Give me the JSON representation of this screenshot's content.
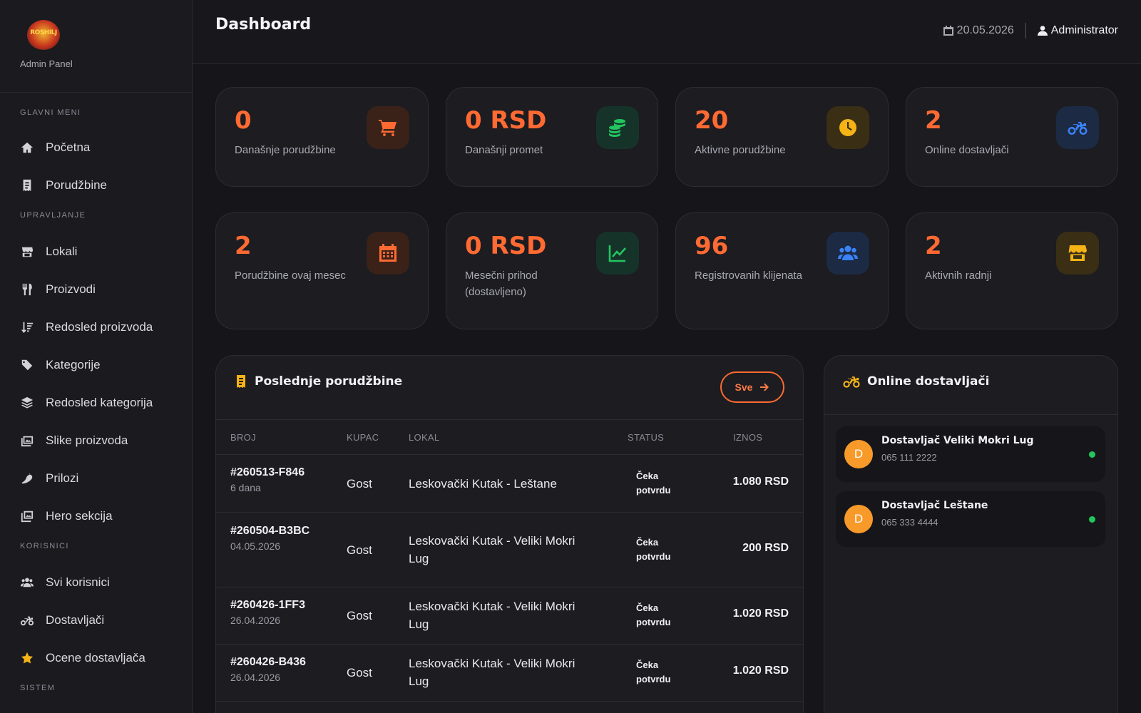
{
  "brand": {
    "logo_text": "ROSHILJ",
    "subtitle": "Admin Panel"
  },
  "nav": {
    "sections": {
      "main": "Glavni meni",
      "manage": "Upravljanje",
      "users": "Korisnici",
      "system": "Sistem"
    },
    "items": [
      {
        "label": "Početna",
        "icon": "home-icon"
      },
      {
        "label": "Porudžbine",
        "icon": "receipt-icon"
      },
      {
        "label": "Lokali",
        "icon": "store-icon"
      },
      {
        "label": "Proizvodi",
        "icon": "utensils-icon"
      },
      {
        "label": "Redosled proizvoda",
        "icon": "sort-icon"
      },
      {
        "label": "Kategorije",
        "icon": "tags-icon"
      },
      {
        "label": "Redosled kategorija",
        "icon": "layers-icon"
      },
      {
        "label": "Slike proizvoda",
        "icon": "images-icon"
      },
      {
        "label": "Prilozi",
        "icon": "pepper-icon"
      },
      {
        "label": "Hero sekcija",
        "icon": "photo-film-icon"
      },
      {
        "label": "Svi korisnici",
        "icon": "users-icon"
      },
      {
        "label": "Dostavljači",
        "icon": "motorcycle-icon"
      },
      {
        "label": "Ocene dostavljača",
        "icon": "star-icon"
      }
    ]
  },
  "header": {
    "title": "Dashboard",
    "date": "20.05.2026",
    "user": "Administrator"
  },
  "stats": [
    {
      "value": "0",
      "label": "Današnje porudžbine",
      "icon": "cart-icon",
      "color": "#ff6a33"
    },
    {
      "value": "0 RSD",
      "label": "Današnji promet",
      "icon": "coins-icon",
      "color": "#22c55e"
    },
    {
      "value": "20",
      "label": "Aktivne porudžbine",
      "icon": "clock-icon",
      "color": "#f5b316"
    },
    {
      "value": "2",
      "label": "Online dostavljači",
      "icon": "motorcycle-icon",
      "color": "#3b82f6"
    },
    {
      "value": "2",
      "label": "Porudžbine ovaj mesec",
      "icon": "calendar-icon",
      "color": "#ff6a33"
    },
    {
      "value": "0 RSD",
      "label": "Mesečni prihod (dostavljeno)",
      "icon": "chart-line-icon",
      "color": "#22c55e"
    },
    {
      "value": "96",
      "label": "Registrovanih klijenata",
      "icon": "users-icon",
      "color": "#3b82f6"
    },
    {
      "value": "2",
      "label": "Aktivnih radnji",
      "icon": "store-icon",
      "color": "#f5b316"
    }
  ],
  "orders": {
    "title": "Poslednje porudžbine",
    "all_button": "Sve",
    "columns": [
      "Broj",
      "Kupac",
      "Lokal",
      "Status",
      "Iznos"
    ],
    "rows": [
      {
        "number": "#260513-F846",
        "date": "6 dana",
        "customer": "Gost",
        "location": "Leskovački Kutak - Leštane",
        "status": "Čeka potvrdu",
        "amount": "1.080 RSD"
      },
      {
        "number": "#260504-B3BC",
        "date": "04.05.2026",
        "customer": "Gost",
        "location": "Leskovački Kutak - Veliki Mokri Lug",
        "status": "Čeka potvrdu",
        "amount": "200 RSD"
      },
      {
        "number": "#260426-1FF3",
        "date": "26.04.2026",
        "customer": "Gost",
        "location": "Leskovački Kutak - Veliki Mokri Lug",
        "status": "Čeka potvrdu",
        "amount": "1.020 RSD"
      },
      {
        "number": "#260426-B436",
        "date": "26.04.2026",
        "customer": "Gost",
        "location": "Leskovački Kutak - Veliki Mokri Lug",
        "status": "Čeka potvrdu",
        "amount": "1.020 RSD"
      }
    ]
  },
  "couriers": {
    "title": "Online dostavljači",
    "items": [
      {
        "initial": "D",
        "name": "Dostavljač Veliki Mokri Lug",
        "phone": "065 111 2222",
        "status_color": "#22c55e"
      },
      {
        "initial": "D",
        "name": "Dostavljač Leštane",
        "phone": "065 333 4444",
        "status_color": "#22c55e"
      }
    ]
  }
}
